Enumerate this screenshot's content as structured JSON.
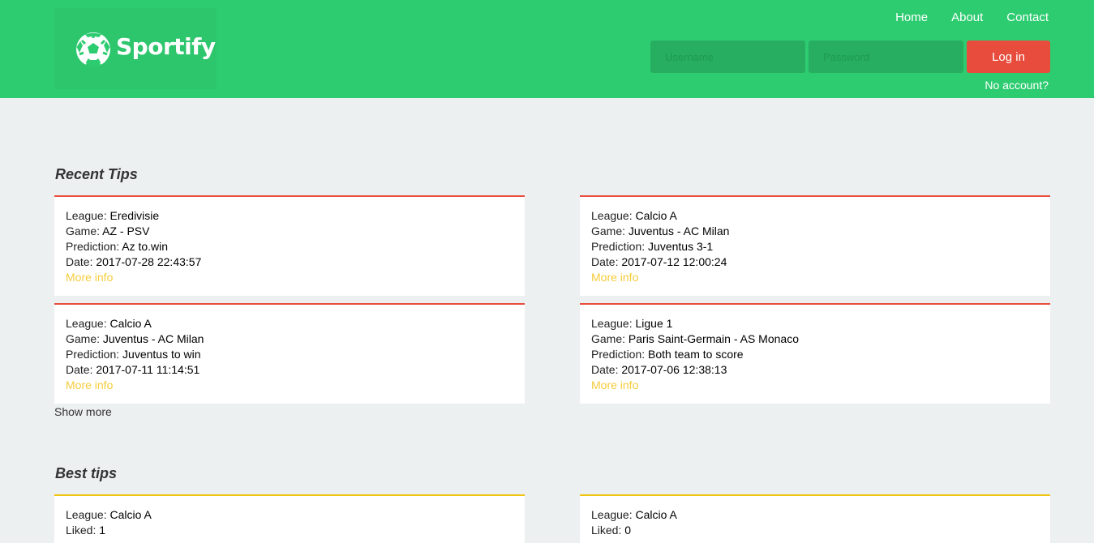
{
  "brand": {
    "name": "Sportify",
    "logo_icon": "soccer-ball-icon"
  },
  "nav": {
    "home": "Home",
    "about": "About",
    "contact": "Contact"
  },
  "login": {
    "username_placeholder": "Username",
    "password_placeholder": "Password",
    "button": "Log in",
    "no_account": "No account?"
  },
  "colors": {
    "header": "#2ecc71",
    "login_button": "#e74c3c",
    "recent_accent": "#e74c3c",
    "best_accent": "#f1c40f",
    "link": "#f5cc3c"
  },
  "labels": {
    "league": "League: ",
    "game": "Game: ",
    "prediction": "Prediction: ",
    "date": "Date: ",
    "liked": "Liked: ",
    "more_info": "More info"
  },
  "recent": {
    "title": "Recent Tips",
    "show_more": "Show more",
    "tips": [
      {
        "league": "Eredivisie",
        "game": "AZ - PSV",
        "prediction": "Az to.win",
        "date": "2017-07-28 22:43:57"
      },
      {
        "league": "Calcio A",
        "game": "Juventus - AC Milan",
        "prediction": "Juventus 3-1",
        "date": "2017-07-12 12:00:24"
      },
      {
        "league": "Calcio A",
        "game": "Juventus - AC Milan",
        "prediction": "Juventus to win",
        "date": "2017-07-11 11:14:51"
      },
      {
        "league": "Ligue 1",
        "game": "Paris Saint-Germain - AS Monaco",
        "prediction": "Both team to score",
        "date": "2017-07-06 12:38:13"
      }
    ]
  },
  "best": {
    "title": "Best tips",
    "tips": [
      {
        "league": "Calcio A",
        "liked": "1"
      },
      {
        "league": "Calcio A",
        "liked": "0"
      }
    ]
  }
}
